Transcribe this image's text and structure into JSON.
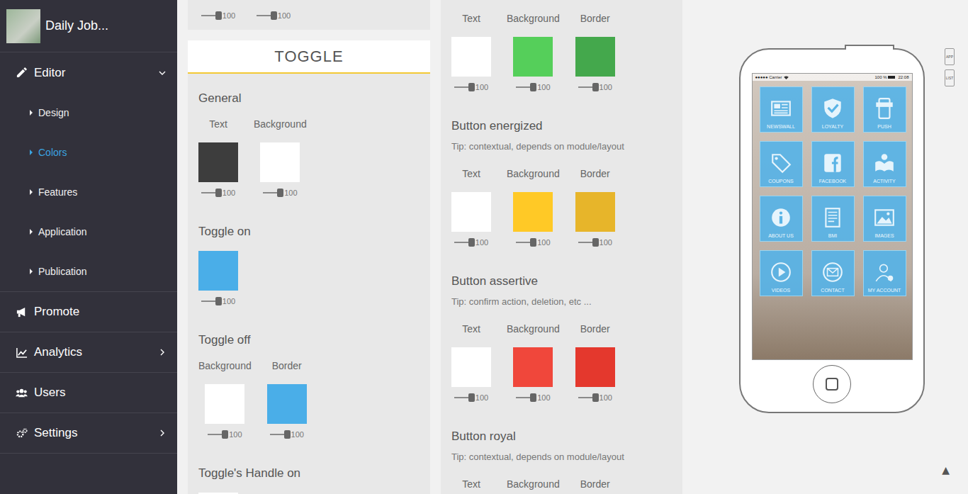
{
  "sidebar": {
    "app_name": "Daily Job...",
    "items": [
      {
        "label": "Editor",
        "expandable": true,
        "expanded": true,
        "children": [
          {
            "label": "Design",
            "selected": false
          },
          {
            "label": "Colors",
            "selected": true
          },
          {
            "label": "Features",
            "selected": false
          },
          {
            "label": "Application",
            "selected": false
          },
          {
            "label": "Publication",
            "selected": false
          }
        ]
      },
      {
        "label": "Promote",
        "expandable": false,
        "expanded": false
      },
      {
        "label": "Analytics",
        "expandable": true,
        "expanded": false
      },
      {
        "label": "Users",
        "expandable": false,
        "expanded": false
      },
      {
        "label": "Settings",
        "expandable": true,
        "expanded": false
      }
    ]
  },
  "columns": [
    {
      "cards": [
        {
          "groups": [
            {
              "kind": "cut",
              "swatches": [
                {
                  "level": 1,
                  "reading": "100"
                },
                {
                  "level": 1,
                  "reading": "100"
                }
              ]
            }
          ]
        },
        {
          "header": "TOGGLE",
          "groups": [
            {
              "kind": "full",
              "title": "General",
              "swatches": [
                {
                  "label": "Text",
                  "color": "#3d3d3d",
                  "level": 1,
                  "reading": "100"
                },
                {
                  "label": "Background",
                  "color": "#ffffff",
                  "level": 1,
                  "reading": "100"
                }
              ]
            },
            {
              "kind": "full",
              "title": "Toggle on",
              "swatches": [
                {
                  "color": "#4aaee8",
                  "level": 1,
                  "reading": "100"
                }
              ]
            },
            {
              "kind": "full",
              "title": "Toggle off",
              "swatches": [
                {
                  "label": "Background",
                  "color": "#ffffff",
                  "level": 1,
                  "reading": "100"
                },
                {
                  "label": "Border",
                  "color": "#4aaee8",
                  "level": 1,
                  "reading": "100"
                }
              ]
            },
            {
              "kind": "full",
              "title": "Toggle's Handle on",
              "swatches": [
                {
                  "color": "#ffffff"
                }
              ]
            }
          ]
        }
      ]
    },
    {
      "cards": [
        {
          "groups": [
            {
              "kind": "full",
              "swatches": [
                {
                  "label": "Text",
                  "color": "#ffffff",
                  "level": 1,
                  "reading": "100"
                },
                {
                  "label": "Background",
                  "color": "#55cf5a",
                  "level": 1,
                  "reading": "100"
                },
                {
                  "label": "Border",
                  "color": "#44a84c",
                  "level": 1,
                  "reading": "100"
                }
              ]
            },
            {
              "kind": "full",
              "title": "Button energized",
              "tip": "Tip: contextual, depends on module/layout",
              "swatches": [
                {
                  "label": "Text",
                  "color": "#ffffff",
                  "level": 1,
                  "reading": "100"
                },
                {
                  "label": "Background",
                  "color": "#ffc926",
                  "level": 1,
                  "reading": "100"
                },
                {
                  "label": "Border",
                  "color": "#e7b52a",
                  "level": 1,
                  "reading": "100"
                }
              ]
            },
            {
              "kind": "full",
              "title": "Button assertive",
              "tip": "Tip: confirm action, deletion, etc ...",
              "swatches": [
                {
                  "label": "Text",
                  "color": "#ffffff",
                  "level": 1,
                  "reading": "100"
                },
                {
                  "label": "Background",
                  "color": "#f0473b",
                  "level": 1,
                  "reading": "100"
                },
                {
                  "label": "Border",
                  "color": "#e4382d",
                  "level": 1,
                  "reading": "100"
                }
              ]
            },
            {
              "kind": "full",
              "title": "Button royal",
              "tip": "Tip: contextual, depends on module/layout",
              "swatches": [
                {
                  "label": "Text"
                },
                {
                  "label": "Background"
                },
                {
                  "label": "Border"
                }
              ]
            }
          ]
        }
      ]
    }
  ],
  "preview": {
    "status": {
      "carrier": "●●●●● Carrier",
      "battery": "100 %",
      "time": "22:08"
    },
    "tiles": [
      {
        "label": "NEWSWALL"
      },
      {
        "label": "LOYALTY"
      },
      {
        "label": "PUSH"
      },
      {
        "label": "COUPONS"
      },
      {
        "label": "FACEBOOK"
      },
      {
        "label": "ACTIVITY"
      },
      {
        "label": "ABOUT US"
      },
      {
        "label": "BMI"
      },
      {
        "label": "IMAGES"
      },
      {
        "label": "VIDEOS"
      },
      {
        "label": "CONTACT"
      },
      {
        "label": "MY ACCOUNT"
      }
    ],
    "side": [
      "APP",
      "LIST"
    ],
    "scroll_top": "▲"
  }
}
